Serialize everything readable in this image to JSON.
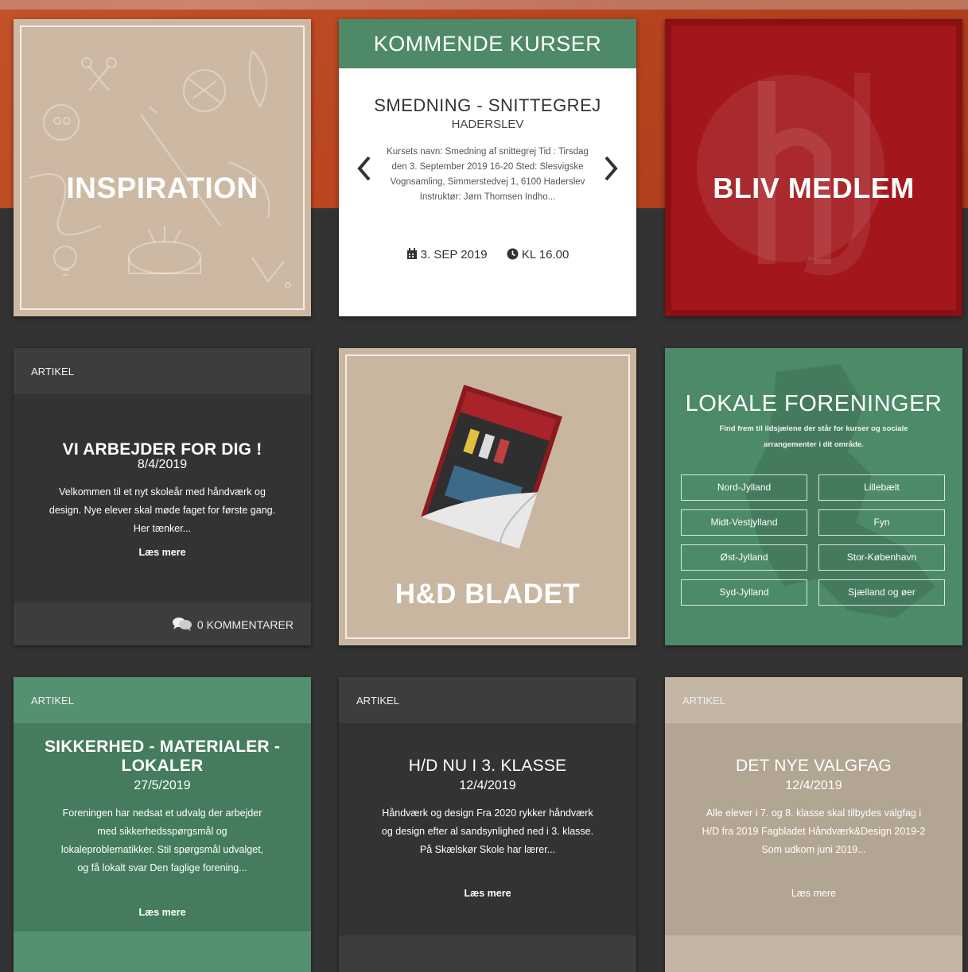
{
  "tiles": {
    "inspiration": {
      "title": "INSPIRATION"
    },
    "courses": {
      "header": "KOMMENDE KURSER",
      "course_title": "SMEDNING - SNITTEGREJ",
      "course_place": "HADERSLEV",
      "description": "Kursets navn: Smedning af snittegrej Tid : Tirsdag den 3. September 2019 16-20 Sted: Slesvigske Vognsamling, Simmerstedvej 1, 6100 Haderslev Instruktør: Jørn Thomsen Indho...",
      "date": "3. SEP 2019",
      "time": "KL 16.00",
      "prev_icon": "chevron-left-icon",
      "next_icon": "chevron-right-icon"
    },
    "member": {
      "title": "BLIV MEDLEM"
    },
    "magazine": {
      "title": "H&D BLADET"
    },
    "local": {
      "title": "LOKALE FORENINGER",
      "subtitle": "Find frem til ildsjælene der står for kurser og sociale arrangementer i dit område.",
      "regions": [
        "Nord-Jylland",
        "Lillebælt",
        "Midt-Vestjylland",
        "Fyn",
        "Øst-Jylland",
        "Stor-København",
        "Syd-Jylland",
        "Sjælland og øer"
      ]
    }
  },
  "articles": [
    {
      "label": "ARTIKEL",
      "title": "VI ARBEJDER FOR DIG !",
      "date": "8/4/2019",
      "text": "Velkommen til et nyt skoleår med håndværk og design.   Nye elever skal møde faget for første gang. Her tænker...",
      "more": "Læs mere",
      "comments": "0 KOMMENTARER"
    },
    {
      "label": "ARTIKEL",
      "title": "SIKKERHED - MATERIALER - LOKALER",
      "date": "27/5/2019",
      "text": "Foreningen har nedsat et udvalg der arbejder med sikkerhedsspørgsmål og lokaleproblematikker. Stil spørgsmål udvalget, og få lokalt svar Den faglige forening...",
      "more": "Læs mere"
    },
    {
      "label": "ARTIKEL",
      "title": "H/D NU I 3. KLASSE",
      "date": "12/4/2019",
      "text": "Håndværk og design Fra 2020 rykker håndværk og design efter al sandsynlighed ned i 3. klasse. På Skælskør Skole har lærer...",
      "more": "Læs mere"
    },
    {
      "label": "ARTIKEL",
      "title": "DET NYE VALGFAG",
      "date": "12/4/2019",
      "text": "Alle elever i 7. og 8. klasse skal tilbydes valgfag i H/D fra 2019 Fagbladet Håndværk&Design 2019-2  Som udkom juni 2019...",
      "more": "Læs mere"
    }
  ],
  "colors": {
    "hero_orange": "#b9461f",
    "dark": "#333333",
    "green": "#4c8a68",
    "beige": "#cdb9a3",
    "red": "#a3171c"
  }
}
